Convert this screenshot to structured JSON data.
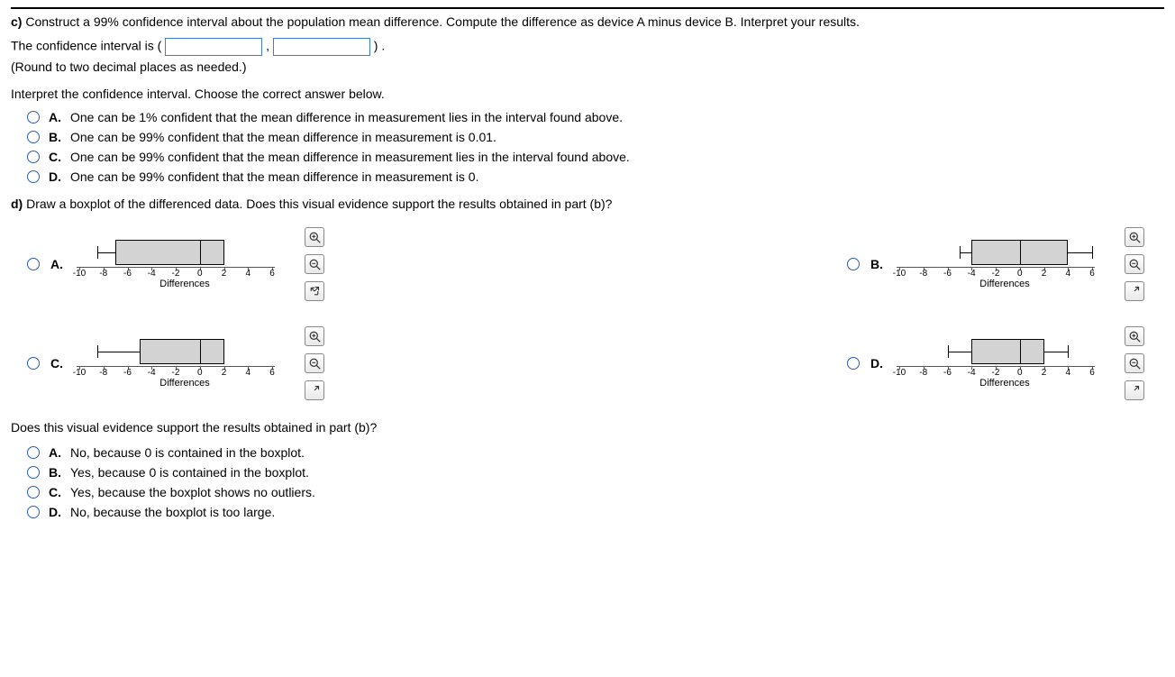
{
  "partC": {
    "prefix": "c)",
    "text": " Construct a 99% confidence interval about the population mean difference. Compute the difference as device A minus device B. Interpret your results."
  },
  "ciLine": {
    "prefix": "The confidence interval is (",
    "comma": ",",
    "suffix": ") ."
  },
  "roundHint": "(Round to two decimal places as needed.)",
  "interpretPrompt": "Interpret the confidence interval. Choose the correct answer below.",
  "interpretChoices": [
    {
      "label": "A.",
      "text": "One can be 1% confident that the mean difference in measurement lies in the interval found above."
    },
    {
      "label": "B.",
      "text": "One can be 99% confident that the mean difference in measurement is 0.01."
    },
    {
      "label": "C.",
      "text": "One can be 99% confident that the mean difference in measurement lies in the interval found above."
    },
    {
      "label": "D.",
      "text": "One can be 99% confident that the mean difference in measurement is 0."
    }
  ],
  "partD": {
    "prefix": "d)",
    "text": " Draw a boxplot of the differenced data. Does this visual evidence support the results obtained in part (b)?"
  },
  "plotLabels": {
    "A": "A.",
    "B": "B.",
    "C": "C.",
    "D": "D."
  },
  "axisTitle": "Differences",
  "axisTicks": [
    "-10",
    "-8",
    "-6",
    "-4",
    "-2",
    "0",
    "2",
    "4",
    "6"
  ],
  "supportPrompt": "Does this visual evidence support the results obtained in part (b)?",
  "supportChoices": [
    {
      "label": "A.",
      "text": "No, because 0 is contained in the boxplot."
    },
    {
      "label": "B.",
      "text": "Yes, because 0 is contained in the boxplot."
    },
    {
      "label": "C.",
      "text": "Yes, because the boxplot shows no outliers."
    },
    {
      "label": "D.",
      "text": "No, because the boxplot is too large."
    }
  ],
  "chart_data": [
    {
      "label": "A",
      "type": "boxplot",
      "xlabel": "Differences",
      "xlim": [
        -10,
        6
      ],
      "low_whisker": -8.5,
      "q1": -7,
      "median": 0,
      "q3": 2,
      "high_whisker": 2
    },
    {
      "label": "B",
      "type": "boxplot",
      "xlabel": "Differences",
      "xlim": [
        -10,
        6
      ],
      "low_whisker": -5,
      "q1": -4,
      "median": 0,
      "q3": 4,
      "high_whisker": 6
    },
    {
      "label": "C",
      "type": "boxplot",
      "xlabel": "Differences",
      "xlim": [
        -10,
        6
      ],
      "low_whisker": -8.5,
      "q1": -5,
      "median": 0,
      "q3": 2,
      "high_whisker": 2
    },
    {
      "label": "D",
      "type": "boxplot",
      "xlabel": "Differences",
      "xlim": [
        -10,
        6
      ],
      "low_whisker": -6,
      "q1": -4,
      "median": 0,
      "q3": 2,
      "high_whisker": 4
    }
  ]
}
